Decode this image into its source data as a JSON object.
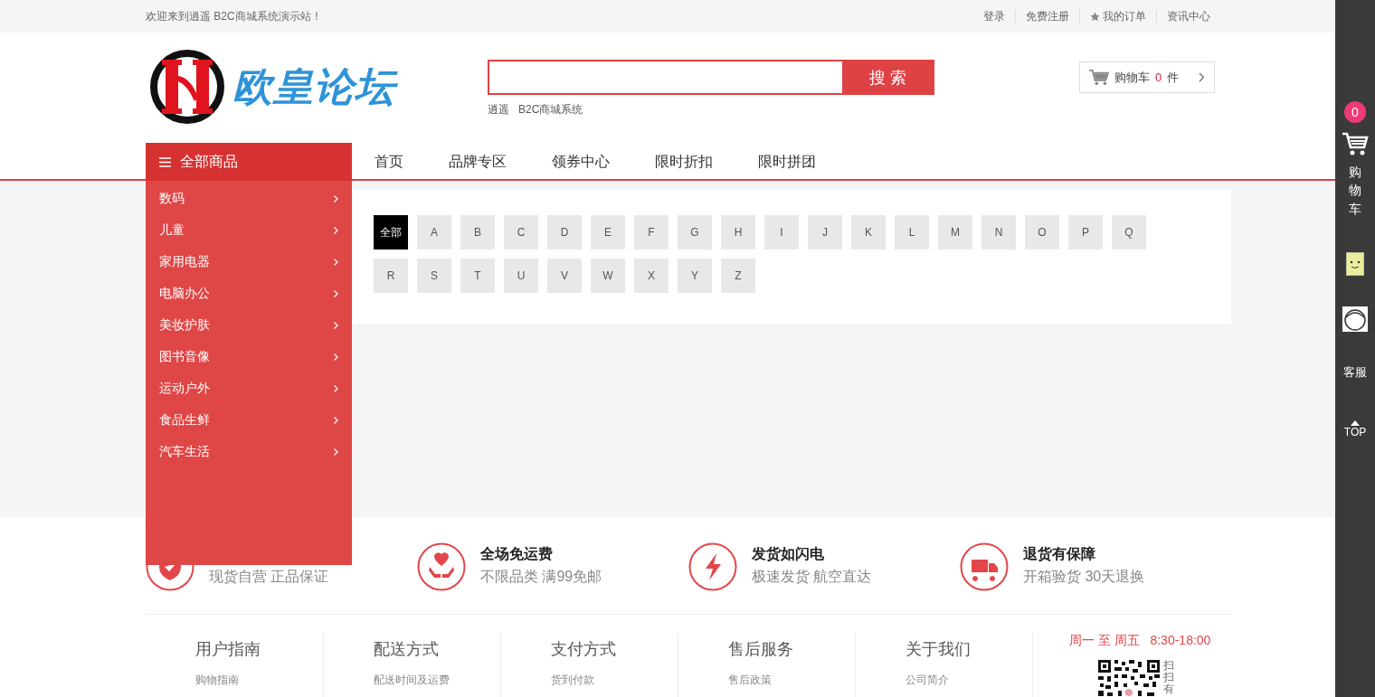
{
  "top_bar": {
    "welcome": "欢迎来到逍遥 B2C商城系统演示站！",
    "links": [
      {
        "label": "登录",
        "kind": "plain"
      },
      {
        "label": "免费注册",
        "kind": "plain"
      },
      {
        "label": "我的订单",
        "kind": "star"
      },
      {
        "label": "资讯中心",
        "kind": "plain"
      }
    ]
  },
  "header": {
    "logo_text": "欧皇论坛",
    "search": {
      "button": "搜 索"
    },
    "hot_words": [
      "逍遥",
      "B2C商城系统"
    ],
    "cart": {
      "label": "购物车",
      "count": "0",
      "unit": "件"
    }
  },
  "nav": {
    "category_title": "全部商品",
    "links": [
      "首页",
      "品牌专区",
      "领券中心",
      "限时折扣",
      "限时拼团"
    ]
  },
  "categories": [
    "数码",
    "儿童",
    "家用电器",
    "电脑办公",
    "美妆护肤",
    "图书音像",
    "运动户外",
    "食品生鲜",
    "汽车生活"
  ],
  "letters": [
    {
      "label": "全部",
      "selected": true
    },
    {
      "label": "A",
      "selected": false
    },
    {
      "label": "B",
      "selected": false
    },
    {
      "label": "C",
      "selected": false
    },
    {
      "label": "D",
      "selected": false
    },
    {
      "label": "E",
      "selected": false
    },
    {
      "label": "F",
      "selected": false
    },
    {
      "label": "G",
      "selected": false
    },
    {
      "label": "H",
      "selected": false
    },
    {
      "label": "I",
      "selected": false
    },
    {
      "label": "J",
      "selected": false
    },
    {
      "label": "K",
      "selected": false
    },
    {
      "label": "L",
      "selected": false
    },
    {
      "label": "M",
      "selected": false
    },
    {
      "label": "N",
      "selected": false
    },
    {
      "label": "O",
      "selected": false
    },
    {
      "label": "P",
      "selected": false
    },
    {
      "label": "Q",
      "selected": false
    },
    {
      "label": "R",
      "selected": false
    },
    {
      "label": "S",
      "selected": false
    },
    {
      "label": "T",
      "selected": false
    },
    {
      "label": "U",
      "selected": false
    },
    {
      "label": "V",
      "selected": false
    },
    {
      "label": "W",
      "selected": false
    },
    {
      "label": "X",
      "selected": false
    },
    {
      "label": "Y",
      "selected": false
    },
    {
      "label": "Z",
      "selected": false
    }
  ],
  "services": [
    {
      "kind": "shield",
      "subtitle": "现货自营 正品保证"
    },
    {
      "kind": "heart",
      "title": "全场免运费",
      "subtitle": "不限品类 满99免邮"
    },
    {
      "kind": "bolt",
      "title": "发货如闪电",
      "subtitle": "极速发货 航空直达"
    },
    {
      "kind": "truck",
      "title": "退货有保障",
      "subtitle": "开箱验货 30天退换"
    }
  ],
  "footer": {
    "columns": [
      {
        "title": "用户指南",
        "link": "购物指南"
      },
      {
        "title": "配送方式",
        "link": "配送时间及运费"
      },
      {
        "title": "支付方式",
        "link": "货到付款"
      },
      {
        "title": "售后服务",
        "link": "售后政策"
      },
      {
        "title": "关于我们",
        "link": "公司简介"
      }
    ],
    "hours": "周一 至 周五   8:30-18:00",
    "qr_caption": "扫扫有"
  },
  "side_bar": {
    "cart_badge": "0",
    "cart_label": "购物车",
    "service_label": "客服",
    "top_label": "TOP"
  }
}
